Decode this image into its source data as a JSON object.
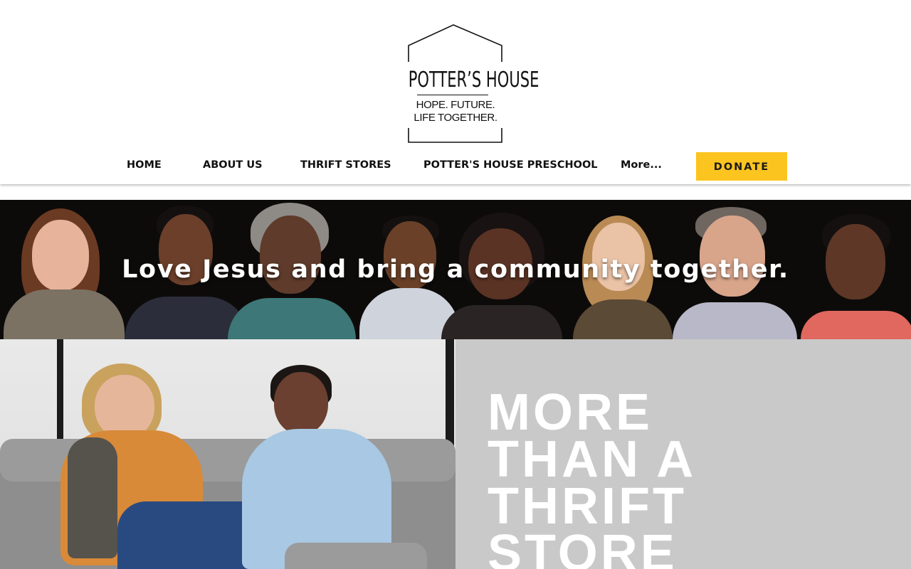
{
  "brand": {
    "name": "POTTER’S HOUSE",
    "tagline_line1": "HOPE. FUTURE.",
    "tagline_line2": "LIFE TOGETHER."
  },
  "nav": {
    "items": [
      {
        "label": "HOME"
      },
      {
        "label": "ABOUT US"
      },
      {
        "label": "THRIFT STORES"
      },
      {
        "label": "POTTER'S HOUSE PRESCHOOL"
      },
      {
        "label": "More..."
      }
    ],
    "donate_label": "DONATE"
  },
  "hero": {
    "tagline": "Love Jesus and bring a community together."
  },
  "feature": {
    "heading_lines": [
      "MORE",
      "THAN A",
      "THRIFT",
      "STORE"
    ]
  },
  "colors": {
    "accent": "#fcc41f",
    "hero_background": "#0d0b0a",
    "panel_grey": "#c9c9c9"
  }
}
